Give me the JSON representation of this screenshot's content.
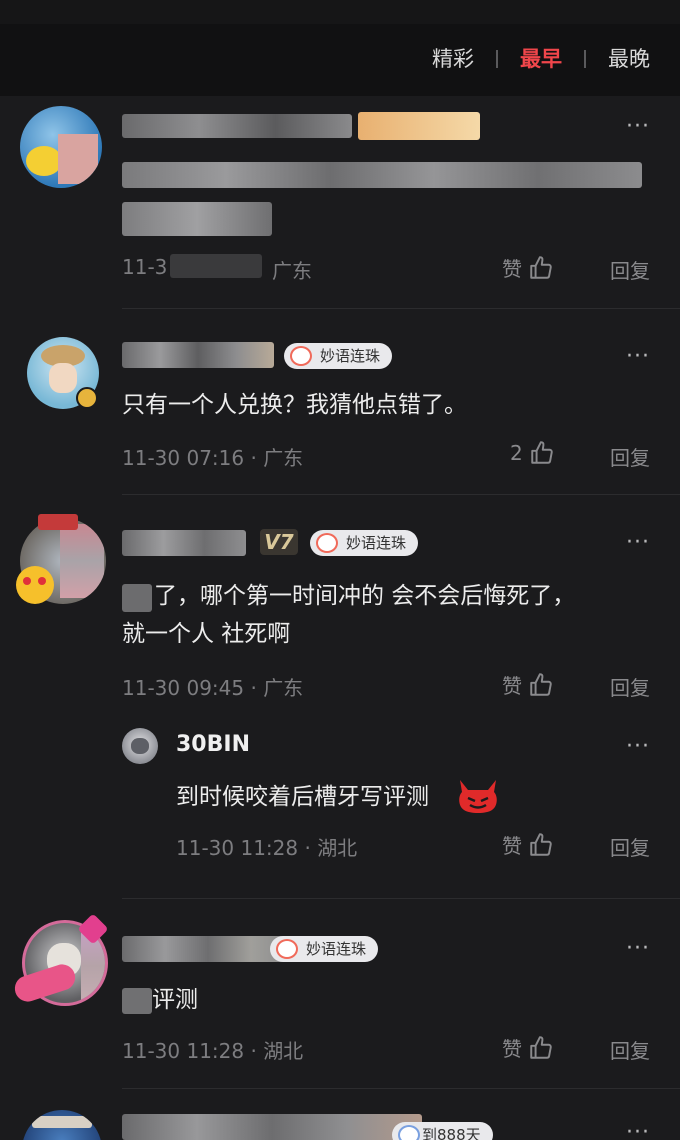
{
  "header": {
    "tabs": [
      {
        "label": "精彩",
        "active": false
      },
      {
        "label": "最早",
        "active": true
      },
      {
        "label": "最晚",
        "active": false
      }
    ]
  },
  "comments": [
    {
      "time": "11-3",
      "location": "广东",
      "like_label": "赞",
      "reply_label": "回复",
      "more": "···"
    },
    {
      "badge": "妙语连珠",
      "content": "只有一个人兑换？我猜他点错了。",
      "time": "11-30 07:16",
      "location": "广东",
      "like_label": "2",
      "reply_label": "回复",
      "more": "···"
    },
    {
      "vip": "V7",
      "badge": "妙语连珠",
      "content_line1": "了，哪个第一时间冲的 会不会后悔死了，",
      "content_line2": "就一个人 社死啊",
      "time": "11-30 09:45",
      "location": "广东",
      "like_label": "赞",
      "reply_label": "回复",
      "more": "···",
      "reply": {
        "username": "30BIN",
        "content": "到时候咬着后槽牙写评测",
        "time": "11-30 11:28",
        "location": "湖北",
        "like_label": "赞",
        "reply_label": "回复",
        "more": "···"
      }
    },
    {
      "badge": "妙语连珠",
      "content": "评测",
      "time": "11-30 11:28",
      "location": "湖北",
      "like_label": "赞",
      "reply_label": "回复",
      "more": "···"
    },
    {
      "badge": "到888天"
    }
  ],
  "colors": {
    "background": "#1b1b1d",
    "header": "#111112",
    "active_tab": "#f0464b"
  }
}
